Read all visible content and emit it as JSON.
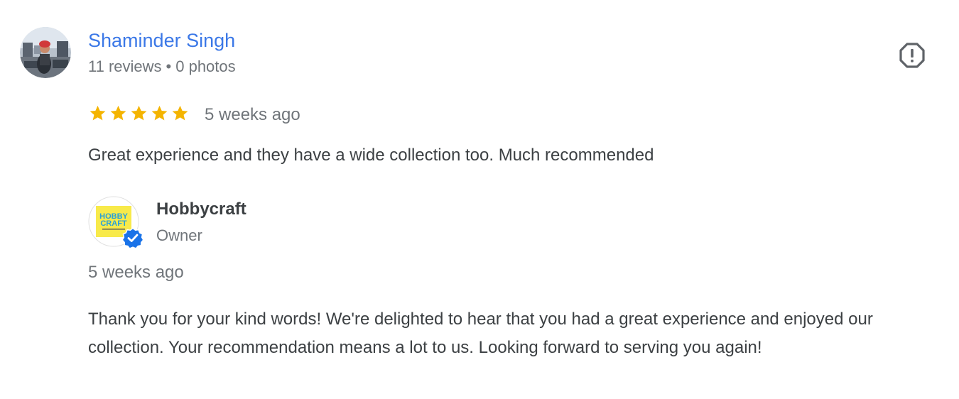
{
  "review": {
    "reviewer": {
      "name": "Shaminder Singh",
      "reviews_count": "11 reviews",
      "separator": "•",
      "photos_count": "0 photos",
      "avatar_icon": "user-avatar"
    },
    "report_icon": "report-flag-icon",
    "rating": 5,
    "rating_max": 5,
    "star_color": "#f4b400",
    "time": "5 weeks ago",
    "text": "Great experience and they have a wide collection too. Much recommended"
  },
  "owner_response": {
    "owner_name": "Hobbycraft",
    "role": "Owner",
    "logo_text_line1": "HOBBY",
    "logo_text_line2": "CRAFT",
    "verified_icon": "verified-badge-icon",
    "verified_color": "#1a73e8",
    "time": "5 weeks ago",
    "text": "Thank you for your kind words! We're delighted to hear that you had a great experience and enjoyed our collection. Your recommendation means a lot to us. Looking forward to serving you again!"
  },
  "colors": {
    "name_link": "#3b78e7",
    "secondary_text": "#70757a",
    "body_text": "#3c4043"
  }
}
